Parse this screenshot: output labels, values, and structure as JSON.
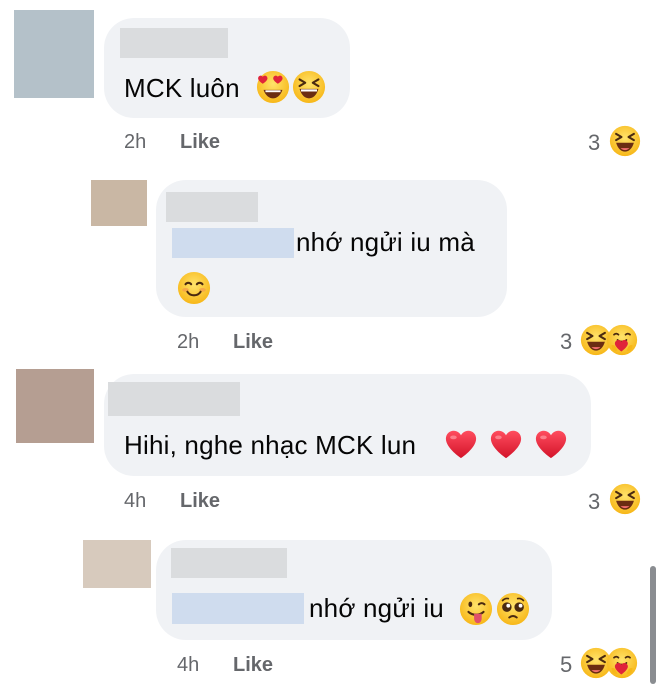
{
  "comments": [
    {
      "text": "MCK luôn",
      "time": "2h",
      "like_label": "Like",
      "reaction_count": "3",
      "emojis": [
        "heart-eyes-emoji",
        "grinning-squint-emoji"
      ],
      "reactions": [
        "haha-reaction"
      ]
    },
    {
      "text": "nhớ ngửi iu mà",
      "time": "2h",
      "like_label": "Like",
      "reaction_count": "3",
      "emojis": [
        "smiling-blush-emoji"
      ],
      "reactions": [
        "haha-reaction",
        "care-reaction"
      ]
    },
    {
      "text": "Hihi, nghe nhạc MCK lun",
      "time": "4h",
      "like_label": "Like",
      "reaction_count": "3",
      "emojis": [
        "red-heart-emoji",
        "red-heart-emoji",
        "red-heart-emoji"
      ],
      "reactions": [
        "haha-reaction"
      ]
    },
    {
      "text": "nhớ ngửi iu",
      "time": "4h",
      "like_label": "Like",
      "reaction_count": "5",
      "emojis": [
        "winking-tongue-emoji",
        "pleading-face-emoji"
      ],
      "reactions": [
        "haha-reaction",
        "care-reaction"
      ]
    }
  ],
  "colors": {
    "bubble": "#f0f2f5",
    "meta_text": "#65676b",
    "name_redaction": "#dadcde",
    "mention_redaction": "#cfdcee",
    "emoji_yellow": "#ffcc33",
    "heart_red": "#e0245e"
  }
}
